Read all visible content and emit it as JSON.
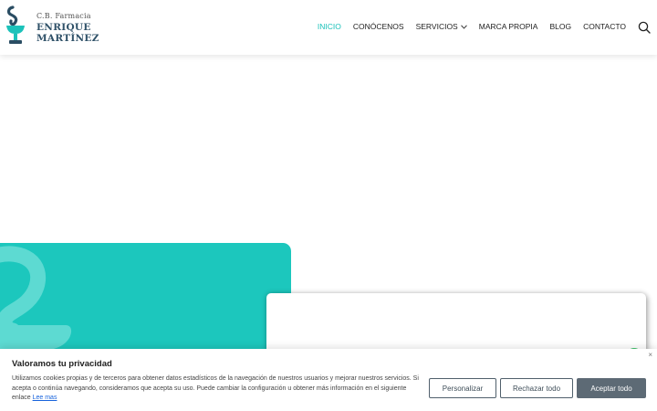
{
  "brand": {
    "small": "C.B. Farmacia",
    "line1": "ENRIQUE",
    "line2": "MARTÍNEZ",
    "logo_icon": "bowl-of-hygieia-icon",
    "color": "#2f5168"
  },
  "nav": {
    "items": [
      {
        "label": "INICIO",
        "active": true
      },
      {
        "label": "CONÓCENOS",
        "active": false
      },
      {
        "label": "SERVICIOS",
        "active": false,
        "has_dropdown": true
      },
      {
        "label": "MARCA PROPIA",
        "active": false
      },
      {
        "label": "BLOG",
        "active": false
      },
      {
        "label": "CONTACTO",
        "active": false
      }
    ],
    "active_color": "#1cc2ba",
    "search_icon": "search-icon"
  },
  "hero": {
    "color": "#1cc7bd"
  },
  "cookie": {
    "title": "Valoramos tu privacidad",
    "text": "Utilizamos cookies propias y de terceros para obtener datos estadísticos de la navegación de nuestros usuarios y mejorar nuestros servicios. Si acepta o continúa navegando, consideramos que acepta su uso. Puede cambiar la configuración u obtener más información en el siguiente enlace",
    "link": "Lee mas",
    "close": "×",
    "buttons": {
      "customize": "Personalizar",
      "reject": "Rechazar todo",
      "accept": "Aceptar todo"
    }
  }
}
